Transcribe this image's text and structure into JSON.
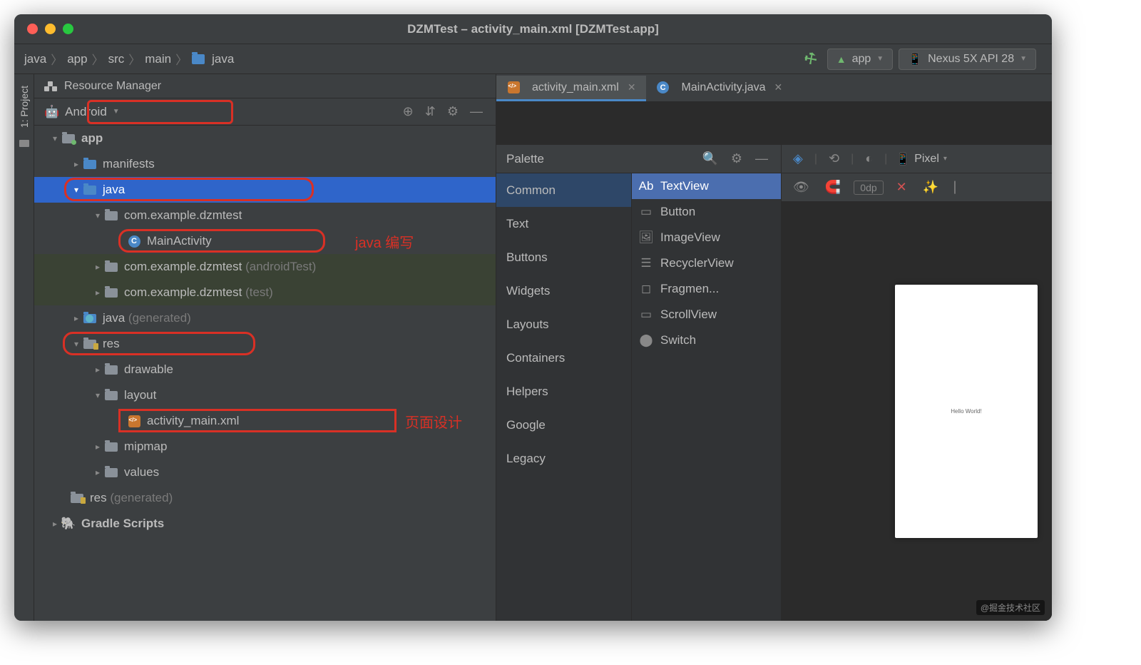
{
  "window": {
    "title": "DZMTest – activity_main.xml [DZMTest.app]"
  },
  "breadcrumbs": [
    "java",
    "app",
    "src",
    "main",
    "java"
  ],
  "toolbar": {
    "config": "app",
    "device": "Nexus 5X API 28"
  },
  "resource_manager": "Resource Manager",
  "sidebar": {
    "view": "Android",
    "vtab": "1: Project"
  },
  "tree": {
    "app": "app",
    "manifests": "manifests",
    "java": "java",
    "pkg": "com.example.dzmtest",
    "main_activity": "MainActivity",
    "pkg_android_test": "com.example.dzmtest",
    "android_test_suffix": "(androidTest)",
    "pkg_test": "com.example.dzmtest",
    "test_suffix": "(test)",
    "java_gen": "java",
    "generated": "(generated)",
    "res": "res",
    "drawable": "drawable",
    "layout": "layout",
    "activity_xml": "activity_main.xml",
    "mipmap": "mipmap",
    "values": "values",
    "res_gen": "res",
    "gradle": "Gradle Scripts"
  },
  "annotations": {
    "java_note": "java 编写",
    "page_note": "页面设计"
  },
  "tabs": [
    {
      "label": "activity_main.xml",
      "type": "xml",
      "active": true
    },
    {
      "label": "MainActivity.java",
      "type": "class",
      "active": false
    }
  ],
  "palette": {
    "title": "Palette",
    "categories": [
      "Common",
      "Text",
      "Buttons",
      "Widgets",
      "Layouts",
      "Containers",
      "Helpers",
      "Google",
      "Legacy"
    ],
    "items": [
      "TextView",
      "Button",
      "ImageView",
      "RecyclerView",
      "Fragmen...",
      "ScrollView",
      "Switch"
    ]
  },
  "design": {
    "device": "Pixel",
    "dp": "0dp",
    "hello": "Hello World!"
  },
  "watermark": "@掘金技术社区"
}
